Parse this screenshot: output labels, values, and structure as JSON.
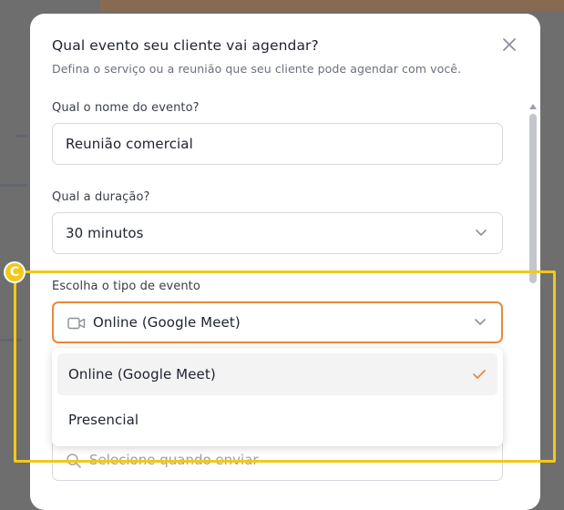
{
  "modal": {
    "title": "Qual evento seu cliente vai agendar?",
    "subtitle": "Defina o serviço ou a reunião que seu cliente pode agendar com você.",
    "close_icon": "close-icon"
  },
  "event_name": {
    "label": "Qual o nome do evento?",
    "value": "Reunião comercial"
  },
  "duration": {
    "label": "Qual a duração?",
    "value": "30 minutos",
    "icon": "chevron-down-icon"
  },
  "event_type": {
    "label": "Escolha o tipo de evento",
    "value": "Online (Google Meet)",
    "icon": "video-camera-icon",
    "options": [
      {
        "label": "Online (Google Meet)",
        "selected": true
      },
      {
        "label": "Presencial",
        "selected": false
      }
    ]
  },
  "send_field": {
    "placeholder": "Selecione quando enviar",
    "icon": "search-icon"
  },
  "annotation": {
    "badge_letter": "C",
    "color": "#f2c81a"
  },
  "colors": {
    "accent": "#e8893a",
    "text": "#20242e",
    "muted": "#6a6f7c"
  }
}
